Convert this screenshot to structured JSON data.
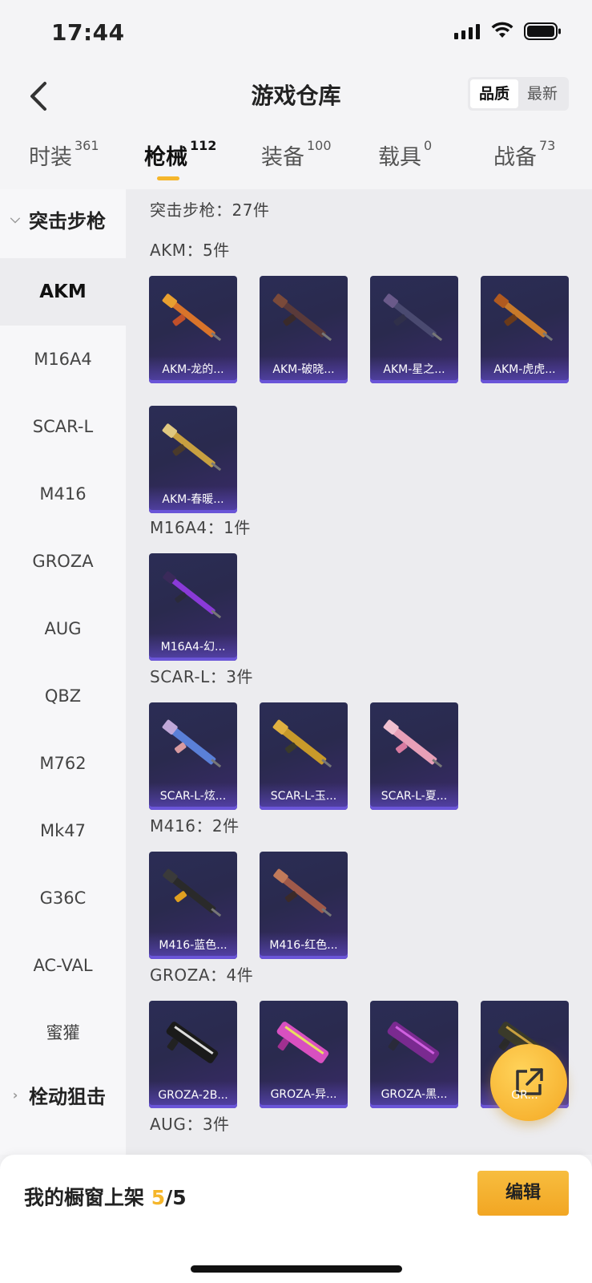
{
  "status_bar": {
    "time": "17:44"
  },
  "header": {
    "title": "游戏仓库",
    "sort_options": [
      "品质",
      "最新"
    ],
    "sort_active": "品质"
  },
  "tabs": [
    {
      "label": "时装",
      "count": "361"
    },
    {
      "label": "枪械",
      "count": "112"
    },
    {
      "label": "装备",
      "count": "100"
    },
    {
      "label": "载具",
      "count": "0"
    },
    {
      "label": "战备",
      "count": "73"
    }
  ],
  "active_tab": "枪械",
  "sidebar": {
    "group_expanded": "突击步枪",
    "items": [
      "AKM",
      "M16A4",
      "SCAR-L",
      "M416",
      "GROZA",
      "AUG",
      "QBZ",
      "M762",
      "Mk47",
      "G36C",
      "AC-VAL",
      "蜜獾"
    ],
    "active_item": "AKM",
    "group_collapsed": "栓动狙击"
  },
  "content": {
    "category_summary": "突击步枪：27件",
    "sections": [
      {
        "title": "AKM：5件",
        "items": [
          "AKM-龙的...",
          "AKM-破晓...",
          "AKM-星之...",
          "AKM-虎虎...",
          "AKM-春暖..."
        ]
      },
      {
        "title": "M16A4：1件",
        "items": [
          "M16A4-幻..."
        ]
      },
      {
        "title": "SCAR-L：3件",
        "items": [
          "SCAR-L-炫...",
          "SCAR-L-玉...",
          "SCAR-L-夏..."
        ]
      },
      {
        "title": "M416：2件",
        "items": [
          "M416-蓝色...",
          "M416-红色..."
        ]
      },
      {
        "title": "GROZA：4件",
        "items": [
          "GROZA-2B...",
          "GROZA-异...",
          "GROZA-黑...",
          "GR..."
        ]
      },
      {
        "title": "AUG：3件",
        "items": []
      }
    ]
  },
  "bottom_bar": {
    "shelf_label": "我的橱窗上架",
    "shelf_current": "5",
    "shelf_total": "/5",
    "edit_label": "编辑"
  },
  "colors": {
    "accent": "#f5b62b",
    "card_bg": "#2b2d55",
    "card_strip": "#6a55d8"
  }
}
